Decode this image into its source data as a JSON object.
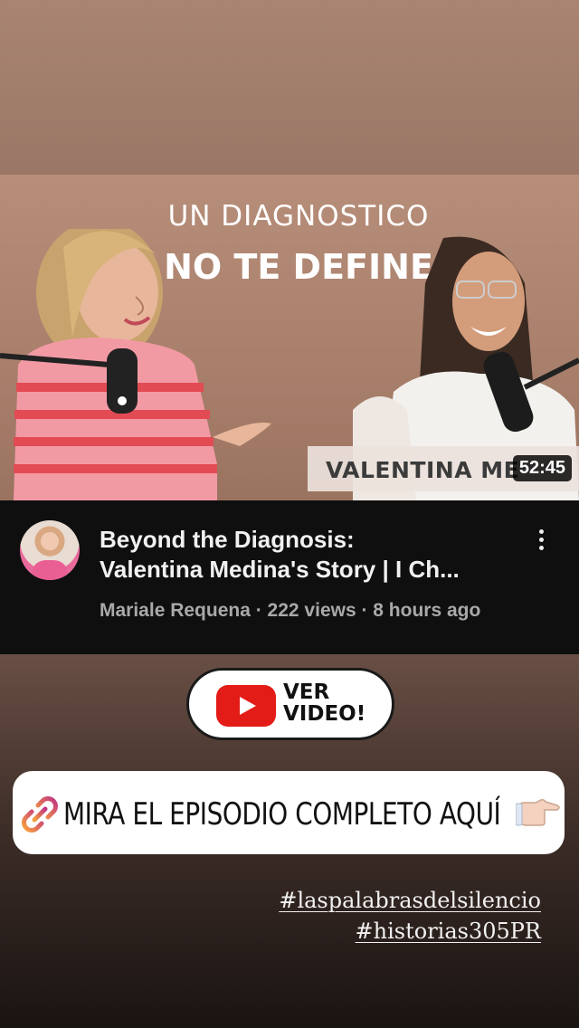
{
  "thumbnail": {
    "line1": "UN DIAGNOSTICO",
    "line2": "NO TE DEFINE",
    "name_tag": "VALENTINA ME",
    "duration": "52:45"
  },
  "video": {
    "title_line1": "Beyond the Diagnosis:",
    "title_line2": "Valentina Medina's Story | I Ch...",
    "meta": "Mariale Requena · 222 views · 8 hours ago",
    "channel_avatar": "avatar-icon",
    "menu_icon": "more-vertical-icon"
  },
  "ver_button": {
    "line1": "VER",
    "line2": "VIDEO!",
    "icon": "youtube-play-icon"
  },
  "link_sticker": {
    "icon": "link-icon",
    "label": "MIRA EL EPISODIO COMPLETO AQUÍ",
    "emoji": "pointing-hand-icon"
  },
  "hashtags": [
    "#laspalabrasdelsilencio",
    "#historias305PR"
  ],
  "colors": {
    "youtube_red": "#e31c17",
    "link_gradient_start": "#f9a23a",
    "link_gradient_end": "#c13584"
  }
}
